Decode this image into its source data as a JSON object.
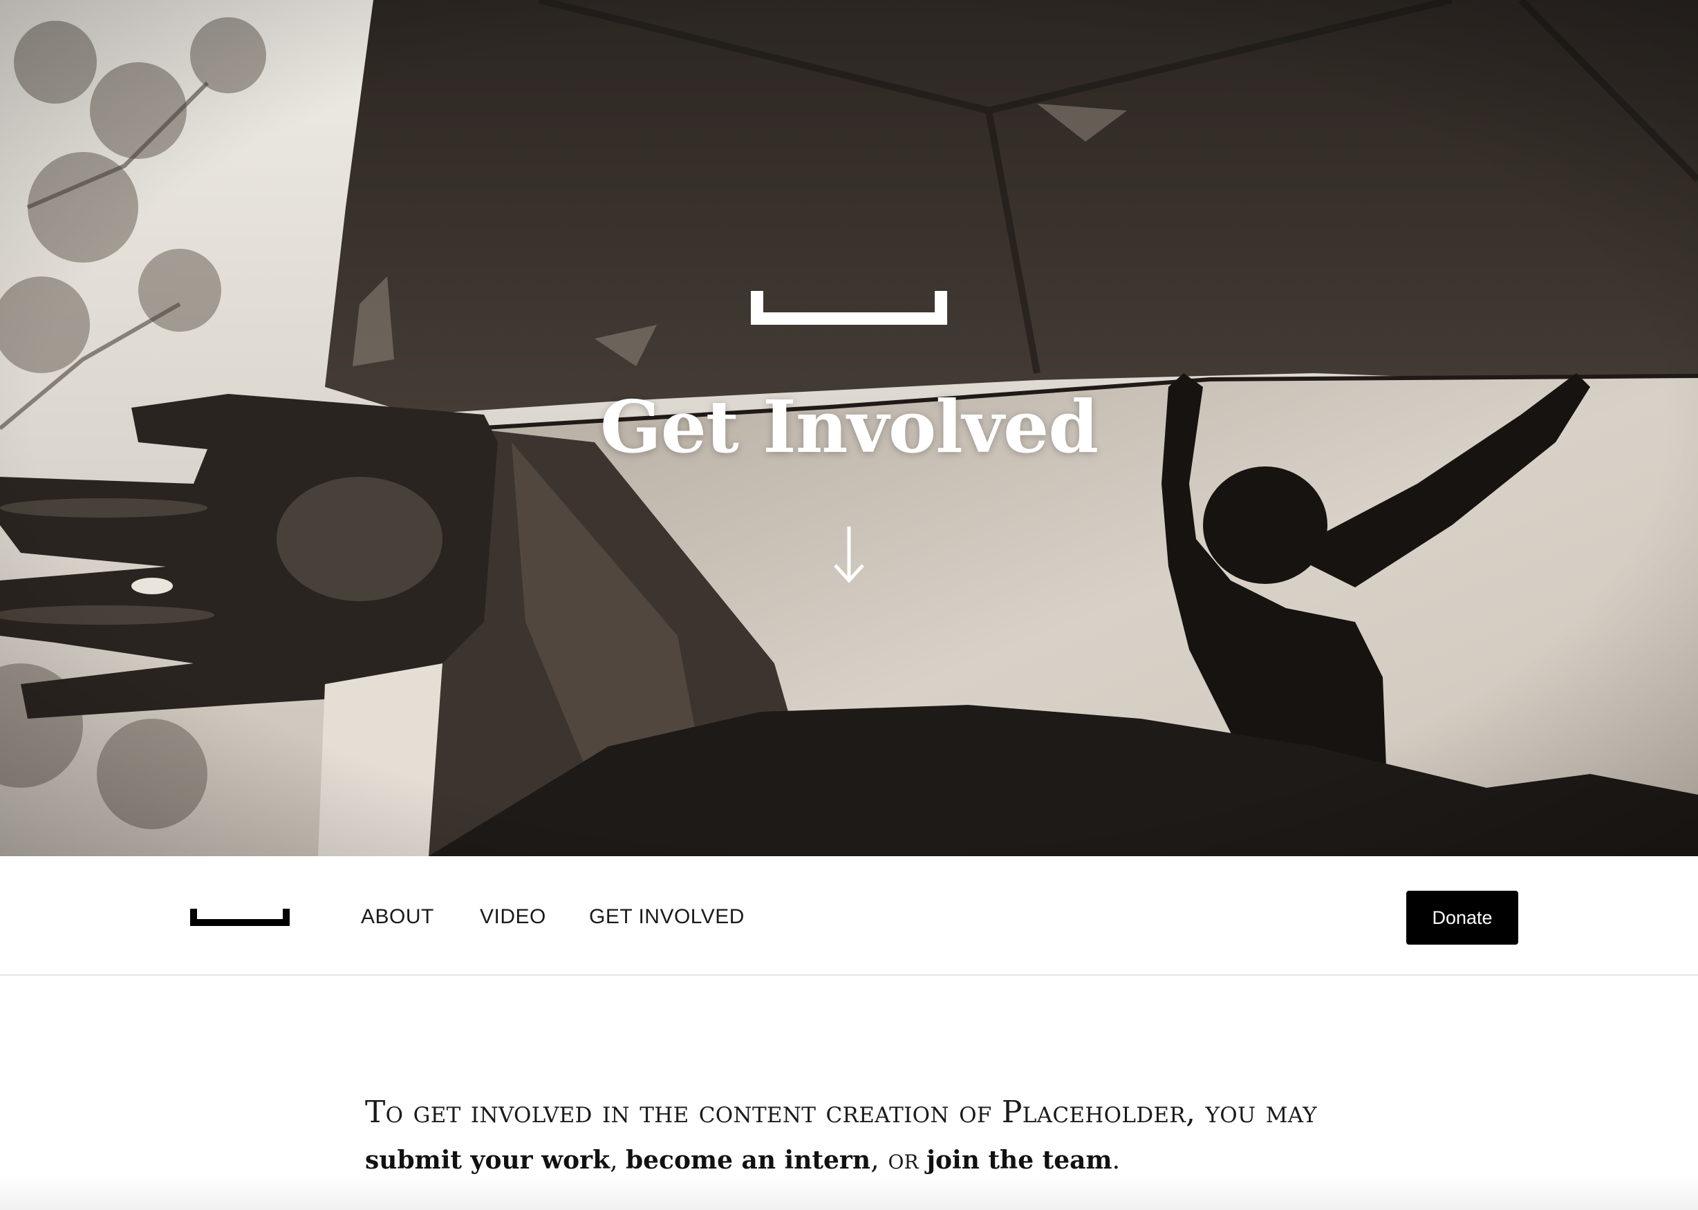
{
  "hero": {
    "title": "Get Involved",
    "logo_icon": "bracket-logo-icon",
    "arrow_icon": "arrow-down-icon",
    "photo": "black-and-white photo of a person silhouetted behind a large cloth held up beside a giant puppet hand"
  },
  "nav": {
    "logo_icon": "bracket-logo-icon",
    "items": [
      {
        "label": "ABOUT"
      },
      {
        "label": "VIDEO"
      },
      {
        "label": "GET INVOLVED"
      }
    ],
    "donate_label": "Donate"
  },
  "intro": {
    "line1": "To get involved in the content creation of Placeholder, you may",
    "link_submit": "submit your work",
    "sep1": ",",
    "link_intern": "become an intern",
    "sep2": ", or",
    "link_team": "join the team",
    "end": "."
  },
  "colors": {
    "donate_bg": "#000000",
    "text": "#1a1a1a",
    "hero_text": "#ffffff"
  }
}
